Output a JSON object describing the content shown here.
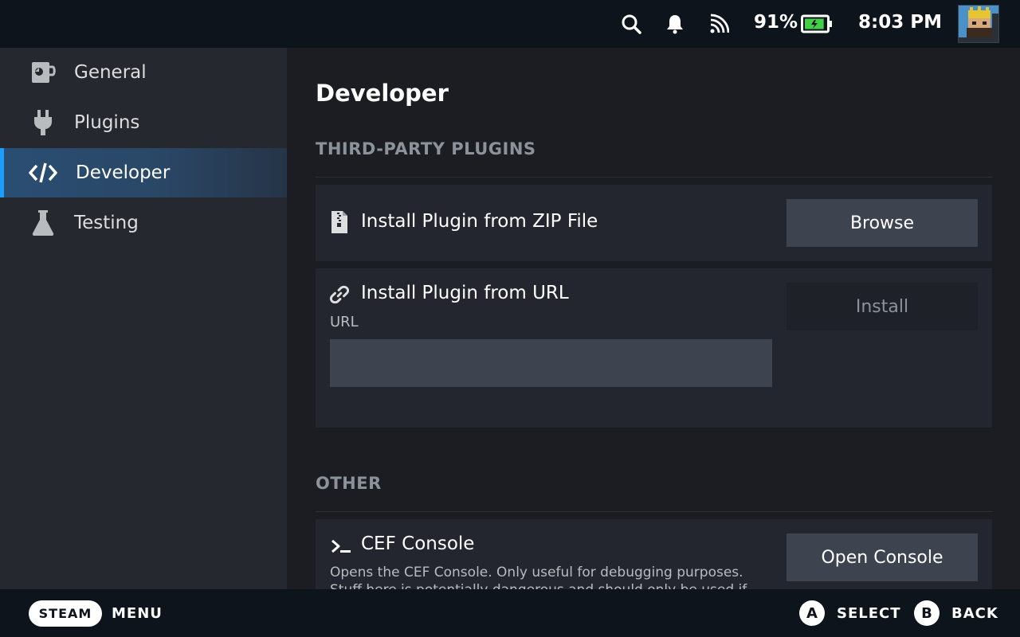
{
  "statusbar": {
    "battery_percent": "91%",
    "battery_level": 0.91,
    "time": "8:03 PM",
    "icons": [
      "search-icon",
      "bell-icon",
      "wifi-icon",
      "battery-icon",
      "avatar"
    ]
  },
  "sidebar": {
    "items": [
      {
        "label": "General",
        "icon": "mug-icon"
      },
      {
        "label": "Plugins",
        "icon": "plug-icon"
      },
      {
        "label": "Developer",
        "icon": "code-icon",
        "active": true
      },
      {
        "label": "Testing",
        "icon": "flask-icon"
      }
    ]
  },
  "main": {
    "title": "Developer",
    "sections": {
      "third_party": {
        "heading": "THIRD-PARTY PLUGINS",
        "zip_row": {
          "label": "Install Plugin from ZIP File",
          "button": "Browse",
          "icon": "zip-file-icon"
        },
        "url_row": {
          "label": "Install Plugin from URL",
          "field_label": "URL",
          "value": "",
          "button": "Install",
          "icon": "link-icon"
        }
      },
      "other": {
        "heading": "OTHER",
        "cef_row": {
          "label": "CEF Console",
          "icon": "terminal-icon",
          "description": "Opens the CEF Console. Only useful for debugging purposes. Stuff here is potentially dangerous and should only be used if",
          "button": "Open Console"
        }
      }
    }
  },
  "bottombar": {
    "steam": "STEAM",
    "menu": "MENU",
    "a_glyph": "A",
    "select": "SELECT",
    "b_glyph": "B",
    "back": "BACK"
  },
  "colors": {
    "accent": "#1a9fff",
    "battery_fill": "#43d047",
    "button_bg": "#3d4450"
  }
}
